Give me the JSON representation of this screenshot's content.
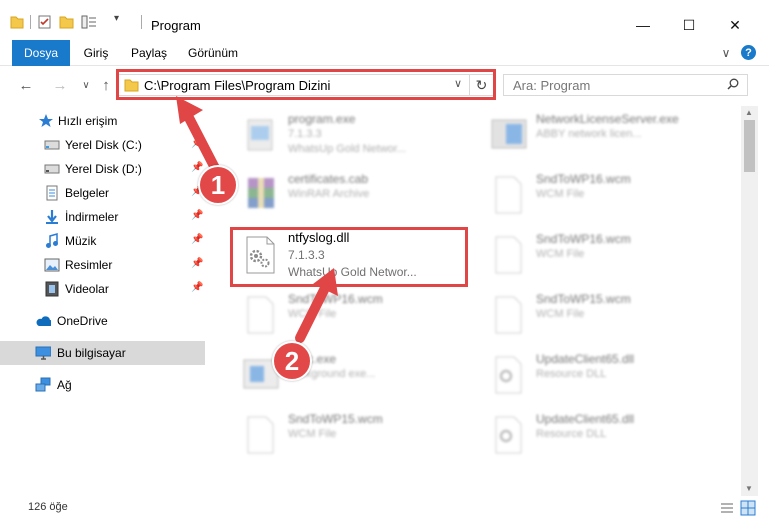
{
  "window": {
    "title": "Program",
    "controls": {
      "minimize": "—",
      "maximize": "☐",
      "close": "✕"
    }
  },
  "ribbon": {
    "tabs": [
      "Dosya",
      "Giriş",
      "Paylaş",
      "Görünüm"
    ],
    "help": "?",
    "expand": "∨"
  },
  "address": {
    "path": "C:\\Program Files\\Program Dizini",
    "dropdown": "∨",
    "refresh": "↻"
  },
  "search": {
    "placeholder": "Ara: Program"
  },
  "nav": {
    "back": "←",
    "forward": "→",
    "recent": "∨",
    "up": "↑",
    "items": [
      {
        "label": "Hızlı erişim",
        "icon": "star-icon"
      },
      {
        "label": "Yerel Disk (C:)",
        "icon": "drive-icon",
        "pinned": true
      },
      {
        "label": "Yerel Disk (D:)",
        "icon": "drive-icon",
        "pinned": true
      },
      {
        "label": "Belgeler",
        "icon": "documents-icon",
        "pinned": true
      },
      {
        "label": "İndirmeler",
        "icon": "download-icon",
        "pinned": true
      },
      {
        "label": "Müzik",
        "icon": "music-icon",
        "pinned": true
      },
      {
        "label": "Resimler",
        "icon": "pictures-icon",
        "pinned": true
      },
      {
        "label": "Videolar",
        "icon": "videos-icon",
        "pinned": true
      },
      {
        "label": "OneDrive",
        "icon": "cloud-icon"
      },
      {
        "label": "Bu bilgisayar",
        "icon": "computer-icon",
        "selected": true
      },
      {
        "label": "Ağ",
        "icon": "network-icon"
      }
    ]
  },
  "files": [
    {
      "name": "program.exe",
      "line1": "7.1.3.3",
      "line2": "WhatsUp Gold Networ...",
      "icon": "exe-icon"
    },
    {
      "name": "NetworkLicenseServer.exe",
      "line1": "ABBY network licen...",
      "line2": "",
      "icon": "exe-icon"
    },
    {
      "name": "certificates.cab",
      "line1": "WinRAR Archive",
      "line2": "",
      "icon": "archive-icon"
    },
    {
      "name": "SndToWP16.wcm",
      "line1": "WCM File",
      "line2": "",
      "icon": "file-icon"
    },
    {
      "name": "ntfyslog.dll",
      "line1": "7.1.3.3",
      "line2": "WhatsUp Gold Networ...",
      "icon": "dll-icon"
    },
    {
      "name": "SndToWP16.wcm",
      "line1": "WCM File",
      "line2": "",
      "icon": "file-icon"
    },
    {
      "name": "SndToWP16.wcm",
      "line1": "WCM File",
      "line2": "",
      "icon": "file-icon"
    },
    {
      "name": "SndToWP15.wcm",
      "line1": "WCM File",
      "line2": "",
      "icon": "file-icon"
    },
    {
      "name": "exec.exe",
      "line1": "background exe...",
      "line2": "",
      "icon": "exe-icon"
    },
    {
      "name": "UpdateClient65.dll",
      "line1": "Resource DLL",
      "line2": "",
      "icon": "dll-icon"
    },
    {
      "name": "SndToWP15.wcm",
      "line1": "WCM File",
      "line2": "",
      "icon": "file-icon"
    },
    {
      "name": "UpdateClient65.dll",
      "line1": "Resource DLL",
      "line2": "",
      "icon": "dll-icon"
    }
  ],
  "status": {
    "count": "126 öğe"
  },
  "annotations": {
    "badge1": "1",
    "badge2": "2",
    "accent": "#e04646",
    "badge_color": "#e34848"
  }
}
